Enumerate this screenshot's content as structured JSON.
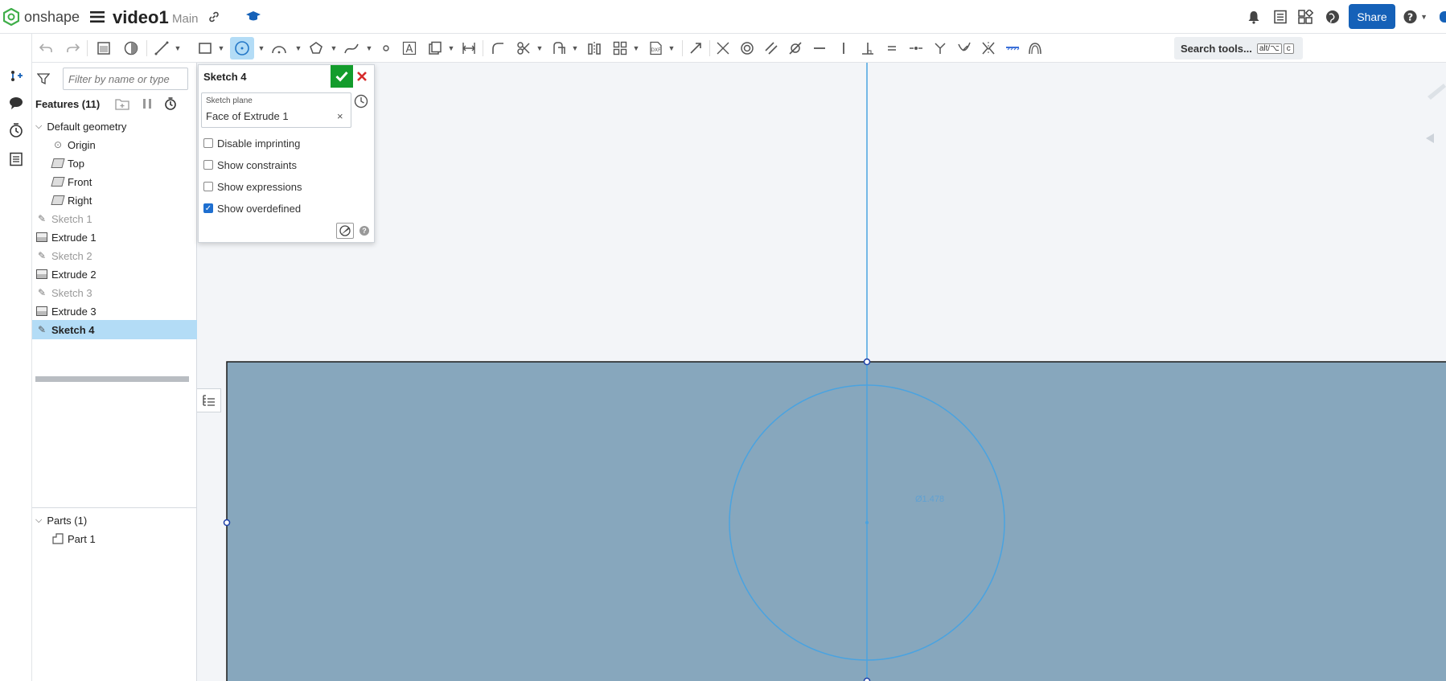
{
  "header": {
    "brand": "onshape",
    "doc_title": "video1",
    "branch": "Main",
    "share_label": "Share"
  },
  "toolbar": {
    "search_label": "Search tools...",
    "search_shortcut_1": "alt/⌥",
    "search_shortcut_2": "c"
  },
  "features": {
    "filter_placeholder": "Filter by name or type",
    "header": "Features (11)",
    "default_geometry": "Default geometry",
    "items": [
      {
        "label": "Origin"
      },
      {
        "label": "Top"
      },
      {
        "label": "Front"
      },
      {
        "label": "Right"
      },
      {
        "label": "Sketch 1"
      },
      {
        "label": "Extrude 1"
      },
      {
        "label": "Sketch 2"
      },
      {
        "label": "Extrude 2"
      },
      {
        "label": "Sketch 3"
      },
      {
        "label": "Extrude 3"
      },
      {
        "label": "Sketch 4"
      }
    ],
    "parts_header": "Parts (1)",
    "parts": [
      {
        "label": "Part 1"
      }
    ]
  },
  "sketch_dialog": {
    "title": "Sketch 4",
    "plane_label": "Sketch plane",
    "plane_value": "Face of Extrude 1",
    "options": [
      {
        "label": "Disable imprinting",
        "checked": false
      },
      {
        "label": "Show constraints",
        "checked": false
      },
      {
        "label": "Show expressions",
        "checked": false
      },
      {
        "label": "Show overdefined",
        "checked": true
      }
    ]
  },
  "viewport": {
    "dimension_label": "Ø1.478"
  },
  "colors": {
    "brand_green": "#3fae49",
    "share_blue": "#1561b8",
    "accept_green": "#139c2c",
    "cancel_red": "#d62b2b",
    "part_face": "#87a7bd",
    "sketch_blue": "#4aa3e0",
    "selection_bg": "#b3dcf6"
  }
}
